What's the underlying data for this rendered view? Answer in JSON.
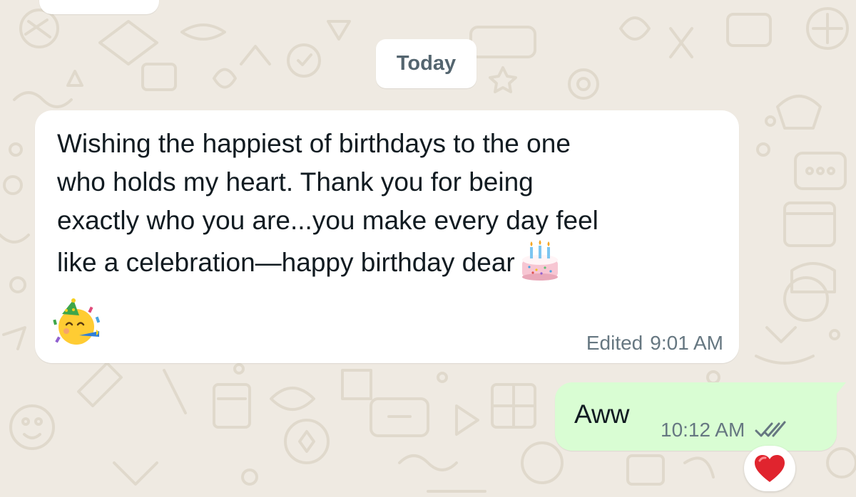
{
  "chat": {
    "date_separator": "Today",
    "incoming_message": {
      "text_lines": [
        "Wishing the happiest of birthdays to the one",
        "who holds my heart. Thank you for being",
        "exactly who you are...you make every day feel",
        "like a celebration—happy birthday dear"
      ],
      "emojis": [
        "birthday-cake-emoji",
        "partying-face-emoji"
      ],
      "edited_label": "Edited",
      "time": "9:01 AM"
    },
    "outgoing_message": {
      "text": "Aww",
      "time": "10:12 AM",
      "status": "read",
      "reaction": "red-heart-emoji"
    }
  },
  "colors": {
    "wallpaper": "#efeae2",
    "wallpaper_doodle": "#e0d9cc",
    "incoming_bubble": "#ffffff",
    "outgoing_bubble": "#d9fdd3",
    "meta_text": "#667781",
    "read_ticks": "#667781",
    "reaction_heart": "#e0242e"
  }
}
